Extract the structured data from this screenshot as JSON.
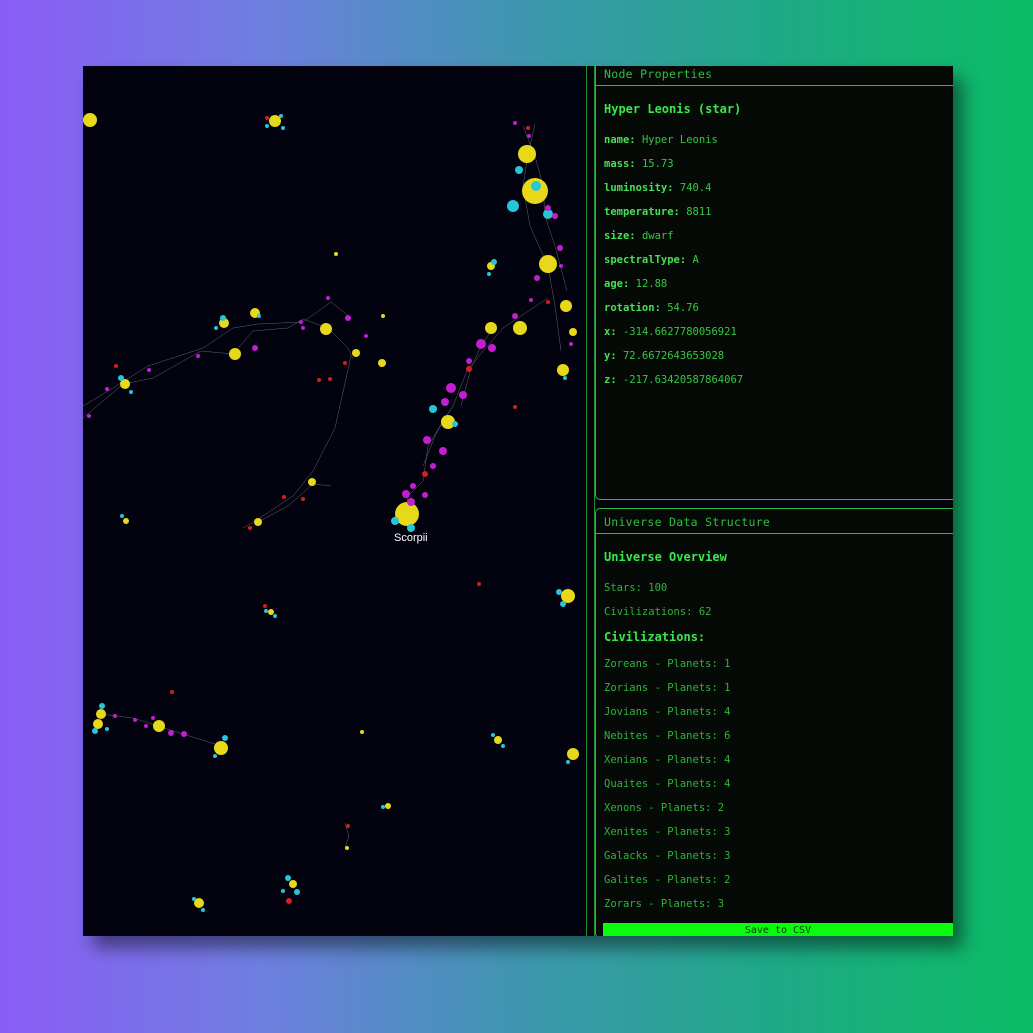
{
  "viewport": {
    "label": "Scorpii",
    "colors": {
      "background": "#03030f",
      "star": "#e8d81a",
      "planet": "#27c6d6",
      "civilization": "#c21fd0",
      "anomaly": "#d21f1f"
    }
  },
  "properties_panel": {
    "title": "Node Properties",
    "node_title": "Hyper Leonis (star)",
    "props": [
      {
        "key": "name:",
        "value": "Hyper Leonis"
      },
      {
        "key": "mass:",
        "value": "15.73"
      },
      {
        "key": "luminosity:",
        "value": "740.4"
      },
      {
        "key": "temperature:",
        "value": "8811"
      },
      {
        "key": "size:",
        "value": "dwarf"
      },
      {
        "key": "spectralType:",
        "value": "A"
      },
      {
        "key": "age:",
        "value": "12.88"
      },
      {
        "key": "rotation:",
        "value": "54.76"
      },
      {
        "key": "x:",
        "value": "-314.6627780056921"
      },
      {
        "key": "y:",
        "value": "72.6672643653028"
      },
      {
        "key": "z:",
        "value": "-217.63420587864067"
      }
    ]
  },
  "universe_panel": {
    "title": "Universe Data Structure",
    "overview_title": "Universe Overview",
    "stars": "Stars: 100",
    "civilizations_count": "Civilizations: 62",
    "civilizations_title": "Civilizations:",
    "civilizations": [
      "Zoreans - Planets: 1",
      "Zorians - Planets: 1",
      "Jovians - Planets: 4",
      "Nebites - Planets: 6",
      "Xenians - Planets: 4",
      "Quaites - Planets: 4",
      "Xenons - Planets: 2",
      "Xenites - Planets: 3",
      "Galacks - Planets: 3",
      "Galites - Planets: 2",
      "Zorars - Planets: 3"
    ]
  },
  "save_button": {
    "label": "Save to CSV"
  }
}
